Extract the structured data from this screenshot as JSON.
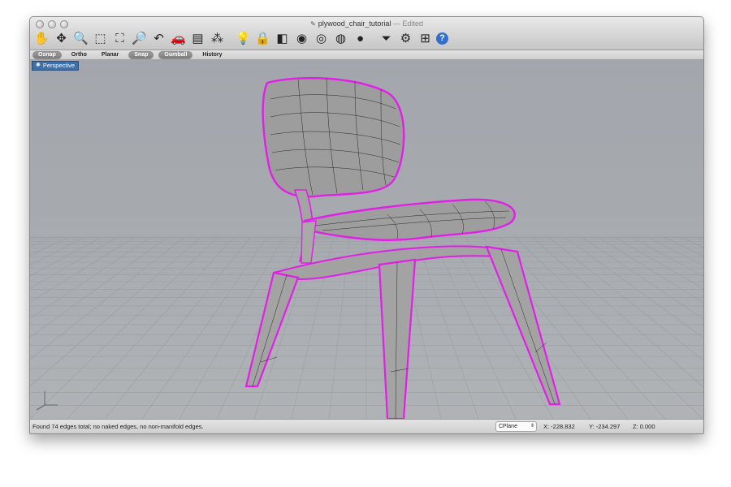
{
  "window": {
    "title": "plywood_chair_tutorial",
    "title_suffix": "— Edited"
  },
  "toolbar": {
    "tools": [
      {
        "name": "pan-icon",
        "glyph": "✋"
      },
      {
        "name": "rotate-icon",
        "glyph": "✥"
      },
      {
        "name": "zoom-icon",
        "glyph": "🔍"
      },
      {
        "name": "zoom-window-icon",
        "glyph": "⬚"
      },
      {
        "name": "zoom-extents-icon",
        "glyph": "⛶"
      },
      {
        "name": "zoom-selected-icon",
        "glyph": "🔎"
      },
      {
        "name": "undo-view-icon",
        "glyph": "↶"
      },
      {
        "name": "car-icon",
        "glyph": "🚗"
      },
      {
        "name": "layer-icon",
        "glyph": "▤"
      },
      {
        "name": "select-points-icon",
        "glyph": "⁂"
      },
      {
        "name": "light-bulb-icon",
        "glyph": "💡"
      },
      {
        "name": "lock-icon",
        "glyph": "🔒"
      },
      {
        "name": "properties-icon",
        "glyph": "◧"
      },
      {
        "name": "color-wheel-icon",
        "glyph": "◉"
      },
      {
        "name": "wireframe-sphere-icon",
        "glyph": "◎"
      },
      {
        "name": "shaded-sphere-icon",
        "glyph": "◍"
      },
      {
        "name": "render-sphere-icon",
        "glyph": "●"
      },
      {
        "name": "funnel-icon",
        "glyph": "⏷"
      },
      {
        "name": "options-icon",
        "glyph": "⚙"
      },
      {
        "name": "network-icon",
        "glyph": "⊞"
      },
      {
        "name": "help-icon",
        "glyph": "?"
      }
    ]
  },
  "commandbar": {
    "osnap": "Osnap",
    "ortho": "Ortho",
    "planar": "Planar",
    "snap": "Snap",
    "gumball": "Gumball",
    "history": "History"
  },
  "viewport": {
    "label": "Perspective"
  },
  "status": {
    "message": "Found 74 edges total; no naked edges, no non-manifold edges.",
    "cplane": "CPlane",
    "x": "X: -228.832",
    "y": "Y: -234.297",
    "z": "Z: 0.000"
  },
  "colors": {
    "edge_highlight": "#e21ee8",
    "viewport_bg": "#a6aaaf",
    "tab_bg": "#3d6fa8"
  }
}
